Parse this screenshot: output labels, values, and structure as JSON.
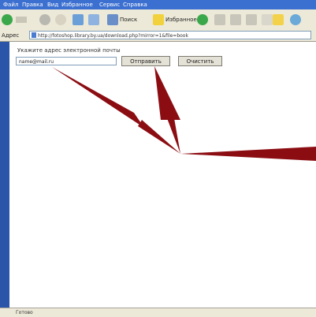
{
  "menubar": {
    "items": [
      "Файл",
      "Правка",
      "Вид",
      "Избранное",
      "Сервис",
      "Справка"
    ]
  },
  "toolbar": {
    "search_label": "Поиск",
    "favorites_label": "Избранное"
  },
  "address": {
    "label": "Адрес",
    "url": "http://fotoshop.library.by.ua/download.php?mirror=1&file=book"
  },
  "form": {
    "label": "Укажите адрес электронной почты",
    "email_value": "name@mail.ru",
    "submit_label": "Отправить",
    "clear_label": "Очистить"
  },
  "status": {
    "text": "Готово"
  },
  "colors": {
    "arrow": "#8b0d12",
    "xp_blue": "#2a55a8",
    "chrome": "#ece9d8"
  }
}
